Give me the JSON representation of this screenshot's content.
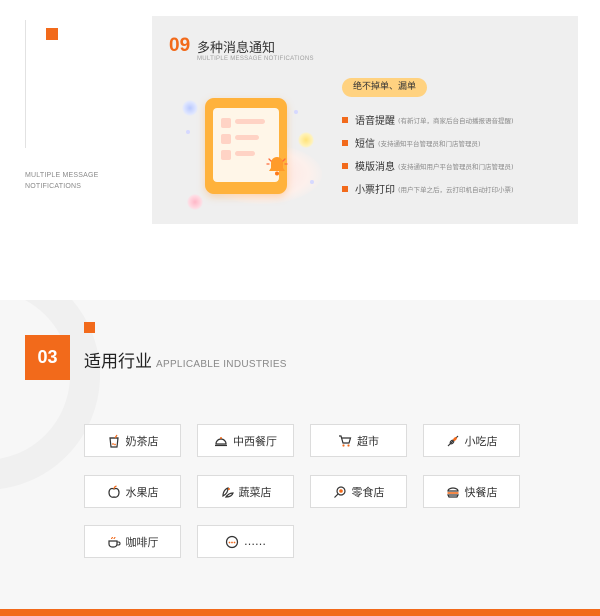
{
  "top": {
    "caption_line1": "MULTIPLE MESSAGE",
    "caption_line2": "NOTIFICATIONS",
    "panel": {
      "number": "09",
      "title": "多种消息通知",
      "subtitle": "MULTIPLE MESSAGE NOTIFICATIONS",
      "pill": "绝不掉单、漏单",
      "features": [
        {
          "name": "语音提醒",
          "desc": "(有新订单，商家后台自动播报语音提醒)"
        },
        {
          "name": "短信",
          "desc": "(支持通知平台管理员和门店管理员)"
        },
        {
          "name": "模版消息",
          "desc": "(支持通知用户平台管理员和门店管理员)"
        },
        {
          "name": "小票打印",
          "desc": "(用户下单之后，云打印机自动打印小票)"
        }
      ]
    }
  },
  "industries": {
    "number": "03",
    "title": "适用行业",
    "title_en": "APPLICABLE INDUSTRIES",
    "items": [
      {
        "label": "奶茶店",
        "icon": "milk-tea-icon"
      },
      {
        "label": "中西餐厅",
        "icon": "cloche-icon"
      },
      {
        "label": "超市",
        "icon": "shopping-cart-icon"
      },
      {
        "label": "小吃店",
        "icon": "skewer-icon"
      },
      {
        "label": "水果店",
        "icon": "apple-icon"
      },
      {
        "label": "蔬菜店",
        "icon": "vegetable-icon"
      },
      {
        "label": "零食店",
        "icon": "lollipop-icon"
      },
      {
        "label": "快餐店",
        "icon": "burger-icon"
      },
      {
        "label": "咖啡厅",
        "icon": "coffee-cup-icon"
      },
      {
        "label": "……",
        "icon": "more-icon"
      }
    ]
  },
  "colors": {
    "accent": "#f26a1b",
    "pill": "#ffd280",
    "panel_bg": "#efefef",
    "band_bg": "#f7f7f7"
  }
}
